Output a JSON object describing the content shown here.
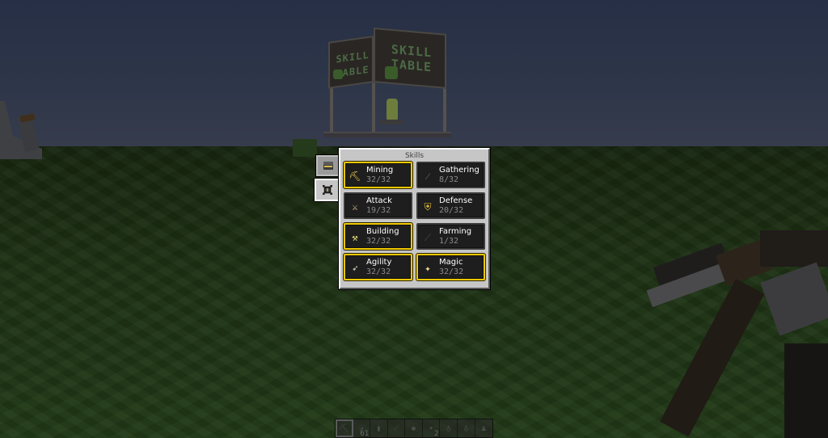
{
  "scene": {
    "structure_sign_text": [
      "SKILL",
      "TABLE"
    ],
    "colors": {
      "sky": "#2e3649",
      "grass": "#1d3114",
      "gui_bg": "#c6c6c6",
      "maxed_border": "#f0c800",
      "cell_bg": "#1e1e1e",
      "level_text": "#8a8a8a"
    }
  },
  "gui": {
    "title": "Skills",
    "tabs": [
      {
        "name": "books-tab",
        "icon": "book-icon",
        "active": false
      },
      {
        "name": "skills-tab",
        "icon": "skill-badge-icon",
        "active": true
      }
    ],
    "skills": [
      {
        "name": "Mining",
        "level": "32/32",
        "current": 32,
        "max": 32,
        "maxed": true,
        "icon": "pickaxe-icon",
        "glyph": "⛏",
        "color": "#f2d24a"
      },
      {
        "name": "Gathering",
        "level": "8/32",
        "current": 8,
        "max": 32,
        "maxed": false,
        "icon": "axe-icon",
        "glyph": "⁄",
        "color": "#7a7a7a"
      },
      {
        "name": "Attack",
        "level": "19/32",
        "current": 19,
        "max": 32,
        "maxed": false,
        "icon": "sword-icon",
        "glyph": "⚔",
        "color": "#d8c48a"
      },
      {
        "name": "Defense",
        "level": "20/32",
        "current": 20,
        "max": 32,
        "maxed": false,
        "icon": "chestplate-icon",
        "glyph": "⛨",
        "color": "#e8c23a"
      },
      {
        "name": "Building",
        "level": "32/32",
        "current": 32,
        "max": 32,
        "maxed": true,
        "icon": "hammer-icon",
        "glyph": "⚒",
        "color": "#f2e27a"
      },
      {
        "name": "Farming",
        "level": "1/32",
        "current": 1,
        "max": 32,
        "maxed": false,
        "icon": "hoe-icon",
        "glyph": "⟋",
        "color": "#4a4a4a"
      },
      {
        "name": "Agility",
        "level": "32/32",
        "current": 32,
        "max": 32,
        "maxed": true,
        "icon": "feather-boot-icon",
        "glyph": "➶",
        "color": "#e8e0c8"
      },
      {
        "name": "Magic",
        "level": "32/32",
        "current": 32,
        "max": 32,
        "maxed": true,
        "icon": "magic-star-icon",
        "glyph": "✦",
        "color": "#f5e08a"
      }
    ]
  },
  "hotbar": {
    "selected": 0,
    "slots": [
      {
        "item": "pickaxe",
        "glyph": "⛏",
        "count": ""
      },
      {
        "item": "arrows",
        "glyph": "↗",
        "count": "61"
      },
      {
        "item": "bars",
        "glyph": "▮",
        "count": ""
      },
      {
        "item": "sword",
        "glyph": "⁄",
        "count": ""
      },
      {
        "item": "emerald",
        "glyph": "◆",
        "count": ""
      },
      {
        "item": "seeds",
        "glyph": "•",
        "count": "2"
      },
      {
        "item": "potion",
        "glyph": "♁",
        "count": ""
      },
      {
        "item": "potion",
        "glyph": "♁",
        "count": ""
      },
      {
        "item": "bottle",
        "glyph": "♟",
        "count": ""
      }
    ]
  }
}
